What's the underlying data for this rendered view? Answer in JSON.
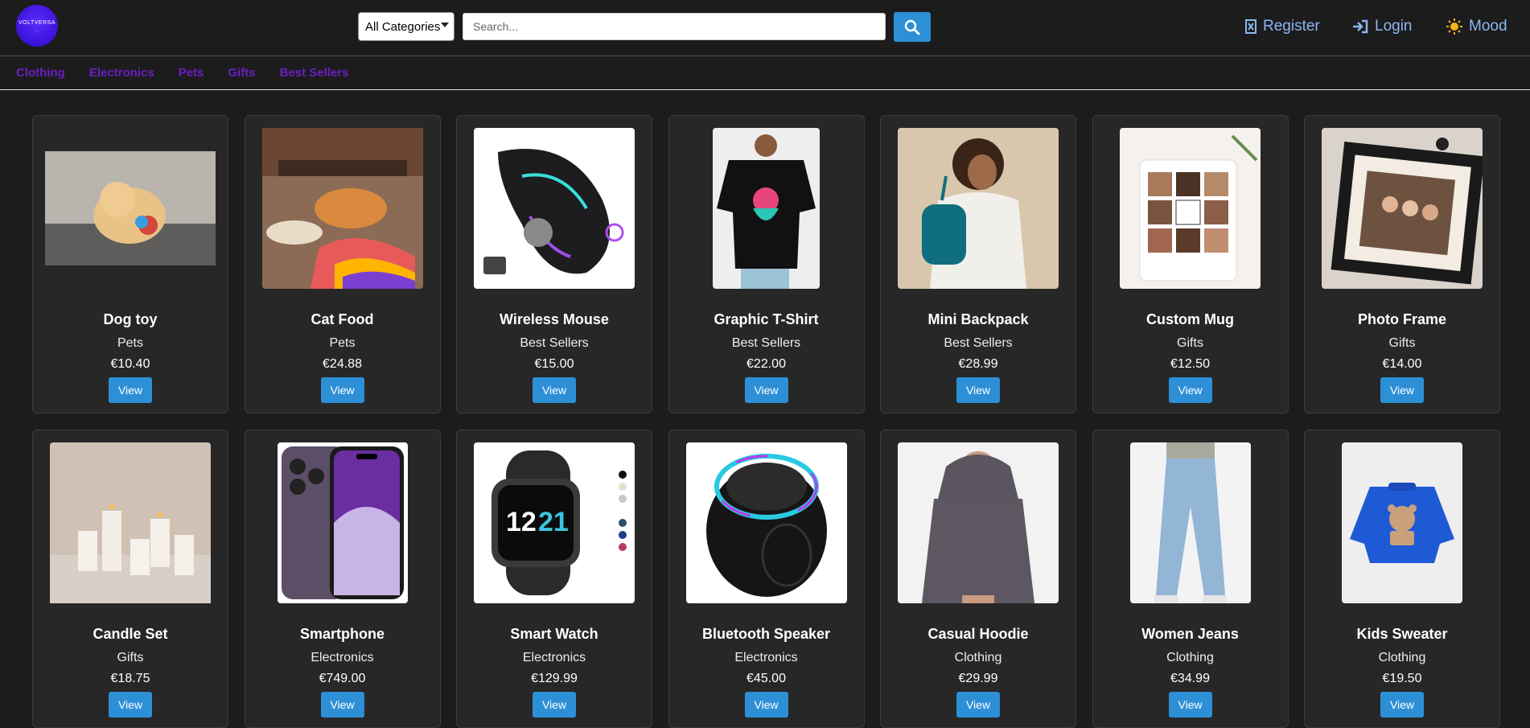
{
  "header": {
    "logo_text": "VOLTVERSA",
    "category_select": "All Categories",
    "search_placeholder": "Search...",
    "register": "Register",
    "login": "Login",
    "mood": "Mood"
  },
  "categories": [
    "Clothing",
    "Electronics",
    "Pets",
    "Gifts",
    "Best Sellers"
  ],
  "products": [
    {
      "name": "Dog toy",
      "category": "Pets",
      "price": "€10.40",
      "view": "View",
      "icon": "dog-toy-image"
    },
    {
      "name": "Cat Food",
      "category": "Pets",
      "price": "€24.88",
      "view": "View",
      "icon": "cat-food-image"
    },
    {
      "name": "Wireless Mouse",
      "category": "Best Sellers",
      "price": "€15.00",
      "view": "View",
      "icon": "wireless-mouse-image"
    },
    {
      "name": "Graphic T-Shirt",
      "category": "Best Sellers",
      "price": "€22.00",
      "view": "View",
      "icon": "graphic-tshirt-image"
    },
    {
      "name": "Mini Backpack",
      "category": "Best Sellers",
      "price": "€28.99",
      "view": "View",
      "icon": "mini-backpack-image"
    },
    {
      "name": "Custom Mug",
      "category": "Gifts",
      "price": "€12.50",
      "view": "View",
      "icon": "custom-mug-image"
    },
    {
      "name": "Photo Frame",
      "category": "Gifts",
      "price": "€14.00",
      "view": "View",
      "icon": "photo-frame-image"
    },
    {
      "name": "Candle Set",
      "category": "Gifts",
      "price": "€18.75",
      "view": "View",
      "icon": "candle-set-image"
    },
    {
      "name": "Smartphone",
      "category": "Electronics",
      "price": "€749.00",
      "view": "View",
      "icon": "smartphone-image"
    },
    {
      "name": "Smart Watch",
      "category": "Electronics",
      "price": "€129.99",
      "view": "View",
      "icon": "smart-watch-image"
    },
    {
      "name": "Bluetooth Speaker",
      "category": "Electronics",
      "price": "€45.00",
      "view": "View",
      "icon": "bluetooth-speaker-image"
    },
    {
      "name": "Casual Hoodie",
      "category": "Clothing",
      "price": "€29.99",
      "view": "View",
      "icon": "casual-hoodie-image"
    },
    {
      "name": "Women Jeans",
      "category": "Clothing",
      "price": "€34.99",
      "view": "View",
      "icon": "women-jeans-image"
    },
    {
      "name": "Kids Sweater",
      "category": "Clothing",
      "price": "€19.50",
      "view": "View",
      "icon": "kids-sweater-image"
    }
  ]
}
